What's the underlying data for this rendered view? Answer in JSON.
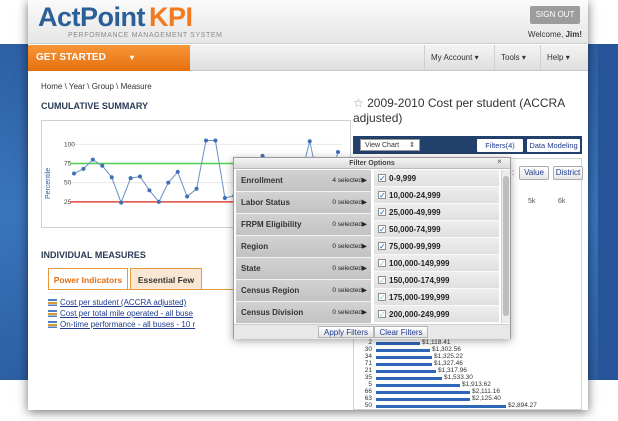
{
  "brand": {
    "name_a": "ActPoint",
    "name_b": "KPI",
    "tagline": "PERFORMANCE MANAGEMENT SYSTEM"
  },
  "header": {
    "signout_label": "SIGN OUT",
    "welcome_prefix": "Welcome, ",
    "welcome_user": "Jim!"
  },
  "nav": {
    "get_started": "GET STARTED",
    "my_account": "My Account",
    "tools": "Tools",
    "help": "Help"
  },
  "breadcrumb": "Home \\ Year \\ Group \\ Measure",
  "summary": {
    "title": "CUMULATIVE SUMMARY",
    "y_label": "Percentile",
    "chart_data": {
      "type": "line",
      "ylabel": "Percentile",
      "yticks": [
        100,
        75,
        50,
        25
      ],
      "ylim": [
        0,
        120
      ],
      "reference_lines": [
        {
          "value": 75,
          "color": "#4fd04f"
        },
        {
          "value": 25,
          "color": "#e04a3a"
        }
      ],
      "values": [
        62,
        68,
        80,
        72,
        57,
        24,
        56,
        58,
        40,
        25,
        50,
        64,
        32,
        42,
        105,
        105,
        30,
        33,
        73,
        40,
        85,
        62,
        28,
        32,
        55,
        104,
        48,
        45,
        90
      ]
    }
  },
  "measures": {
    "title": "INDIVIDUAL MEASURES",
    "tabs": [
      "Power Indicators",
      "Essential Few"
    ],
    "items": [
      "Cost per student (ACCRA adjusted)",
      "Cost per total mile operated - all buse",
      "On-time performance - all buses - 10 r"
    ]
  },
  "detail": {
    "star": "☆",
    "title": "2009-2010 Cost per student (ACCRA adjusted)",
    "view_chart": "View Chart",
    "filters_btn": "Filters(4)",
    "data_modeling_btn": "Data Modeling",
    "colon": ":",
    "value_btn": "Value",
    "district_btn": "District",
    "axis_labels": [
      "4k",
      "5k",
      "6k"
    ],
    "bars": [
      {
        "id": "2",
        "value": "$1,118.41",
        "frac": 0.22
      },
      {
        "id": "30",
        "value": "$1,302.56",
        "frac": 0.27
      },
      {
        "id": "34",
        "value": "$1,325.22",
        "frac": 0.28
      },
      {
        "id": "71",
        "value": "$1,327.46",
        "frac": 0.28
      },
      {
        "id": "21",
        "value": "$1,317.96",
        "frac": 0.3
      },
      {
        "id": "35",
        "value": "$1,533.30",
        "frac": 0.33
      },
      {
        "id": "5",
        "value": "$1,913.62",
        "frac": 0.42
      },
      {
        "id": "66",
        "value": "$2,111.16",
        "frac": 0.47
      },
      {
        "id": "63",
        "value": "$2,125.40",
        "frac": 0.47
      },
      {
        "id": "50",
        "value": "$2,894.27",
        "frac": 0.65
      }
    ]
  },
  "filter": {
    "title": "Filter Options",
    "close": "×",
    "categories": [
      {
        "label": "Enrollment",
        "count": "4 selected"
      },
      {
        "label": "Labor Status",
        "count": "0 selected"
      },
      {
        "label": "FRPM Eligibility",
        "count": "0 selected"
      },
      {
        "label": "Region",
        "count": "0 selected"
      },
      {
        "label": "State",
        "count": "0 selected"
      },
      {
        "label": "Census Region",
        "count": "0 selected"
      },
      {
        "label": "Census Division",
        "count": "0 selected"
      }
    ],
    "options": [
      {
        "label": "0-9,999",
        "checked": true
      },
      {
        "label": "10,000-24,999",
        "checked": true
      },
      {
        "label": "25,000-49,999",
        "checked": true
      },
      {
        "label": "50,000-74,999",
        "checked": true
      },
      {
        "label": "75,000-99,999",
        "checked": true
      },
      {
        "label": "100,000-149,999",
        "checked": false
      },
      {
        "label": "150,000-174,999",
        "checked": false
      },
      {
        "label": "175,000-199,999",
        "checked": false
      },
      {
        "label": "200,000-249,999",
        "checked": false
      }
    ],
    "apply": "Apply Filters",
    "clear": "Clear Filters"
  },
  "colors": {
    "accent": "#f47a1f",
    "brand_blue": "#2b5f98",
    "toolbar": "#21406b",
    "bar": "#2f67b8"
  }
}
